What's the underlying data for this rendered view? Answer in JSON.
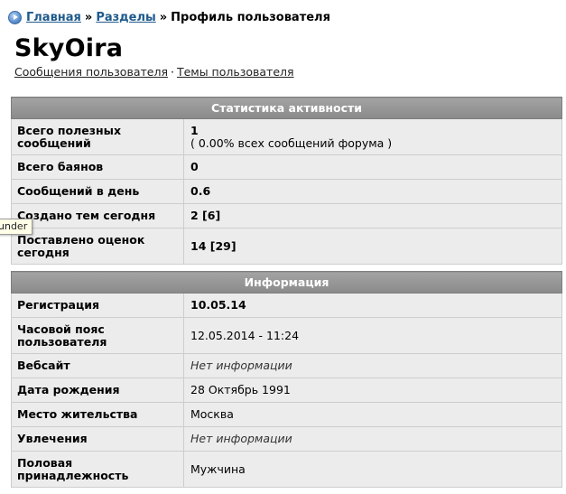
{
  "breadcrumb": {
    "home": "Главная",
    "sections": "Разделы",
    "separator": "»",
    "current": "Профиль пользователя"
  },
  "user": {
    "name": "SkyOira",
    "links": {
      "messages": "Сообщения пользователя",
      "dot": "·",
      "topics": "Темы пользователя"
    }
  },
  "tooltip": "under",
  "activity": {
    "title": "Статистика активности",
    "rows": [
      {
        "label": "Всего полезных сообщений",
        "value": "1",
        "sub": "( 0.00% всех сообщений форума )"
      },
      {
        "label": "Всего баянов",
        "value": "0"
      },
      {
        "label": "Сообщений в день",
        "value": "0.6"
      },
      {
        "label": "Создано тем сегодня",
        "value": "2 [6]"
      },
      {
        "label": "Поставлено оценок сегодня",
        "value": "14 [29]"
      }
    ]
  },
  "info": {
    "title": "Информация",
    "rows": [
      {
        "label": "Регистрация",
        "value": "10.05.14"
      },
      {
        "label": "Часовой пояс пользователя",
        "value": "12.05.2014 - 11:24"
      },
      {
        "label": "Вебсайт",
        "value": "Нет информации"
      },
      {
        "label": "Дата рождения",
        "value": "28 Октябрь 1991"
      },
      {
        "label": "Место жительства",
        "value": "Москва"
      },
      {
        "label": "Увлечения",
        "value": "Нет информации"
      },
      {
        "label": "Половая принадлежность",
        "value": "Мужчина"
      }
    ]
  }
}
